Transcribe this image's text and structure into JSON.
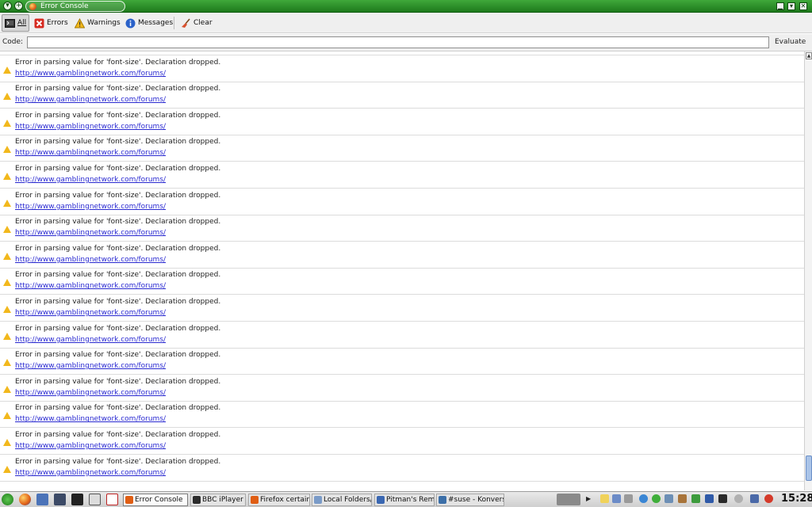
{
  "window": {
    "title": "Error Console"
  },
  "toolbar": {
    "all_label": "All",
    "errors_label": "Errors",
    "warnings_label": "Warnings",
    "messages_label": "Messages",
    "clear_label": "Clear"
  },
  "code": {
    "label": "Code:",
    "value": "",
    "evaluate_label": "Evaluate"
  },
  "messages": [
    {
      "text": "",
      "url": "http://www.gamblingnetwork.com/forums/"
    },
    {
      "text": "Error in parsing value for 'font-size'.  Declaration dropped.",
      "url": "http://www.gamblingnetwork.com/forums/"
    },
    {
      "text": "Error in parsing value for 'font-size'.  Declaration dropped.",
      "url": "http://www.gamblingnetwork.com/forums/"
    },
    {
      "text": "Error in parsing value for 'font-size'.  Declaration dropped.",
      "url": "http://www.gamblingnetwork.com/forums/"
    },
    {
      "text": "Error in parsing value for 'font-size'.  Declaration dropped.",
      "url": "http://www.gamblingnetwork.com/forums/"
    },
    {
      "text": "Error in parsing value for 'font-size'.  Declaration dropped.",
      "url": "http://www.gamblingnetwork.com/forums/"
    },
    {
      "text": "Error in parsing value for 'font-size'.  Declaration dropped.",
      "url": "http://www.gamblingnetwork.com/forums/"
    },
    {
      "text": "Error in parsing value for 'font-size'.  Declaration dropped.",
      "url": "http://www.gamblingnetwork.com/forums/"
    },
    {
      "text": "Error in parsing value for 'font-size'.  Declaration dropped.",
      "url": "http://www.gamblingnetwork.com/forums/"
    },
    {
      "text": "Error in parsing value for 'font-size'.  Declaration dropped.",
      "url": "http://www.gamblingnetwork.com/forums/"
    },
    {
      "text": "Error in parsing value for 'font-size'.  Declaration dropped.",
      "url": "http://www.gamblingnetwork.com/forums/"
    },
    {
      "text": "Error in parsing value for 'font-size'.  Declaration dropped.",
      "url": "http://www.gamblingnetwork.com/forums/"
    },
    {
      "text": "Error in parsing value for 'font-size'.  Declaration dropped.",
      "url": "http://www.gamblingnetwork.com/forums/"
    },
    {
      "text": "Error in parsing value for 'font-size'.  Declaration dropped.",
      "url": "http://www.gamblingnetwork.com/forums/"
    },
    {
      "text": "Error in parsing value for 'font-size'.  Declaration dropped.",
      "url": "http://www.gamblingnetwork.com/forums/"
    },
    {
      "text": "Error in parsing value for 'font-size'.  Declaration dropped.",
      "url": "http://www.gamblingnetwork.com/forums/"
    },
    {
      "text": "Error in parsing value for 'font-size'.  Declaration dropped.",
      "url": "http://www.gamblingnetwork.com/forums/"
    }
  ],
  "taskbar": {
    "tasks": [
      {
        "label": "Error Console",
        "active": true
      },
      {
        "label": "BBC iPlayer - T",
        "active": false
      },
      {
        "label": "Firefox certain",
        "active": false
      },
      {
        "label": "Local Folders/",
        "active": false
      },
      {
        "label": "Pitman's Remo",
        "active": false
      },
      {
        "label": "#suse - Konvers",
        "active": false
      }
    ],
    "clock": "15:28"
  },
  "colors": {
    "title_green": "#2e8f2b",
    "warning": "#f2b81c",
    "link": "#2a2ad1"
  },
  "icons": {
    "all": "console-icon",
    "errors": "error-x-icon",
    "warnings": "warning-triangle-icon",
    "messages": "info-icon",
    "clear": "broom-icon"
  }
}
